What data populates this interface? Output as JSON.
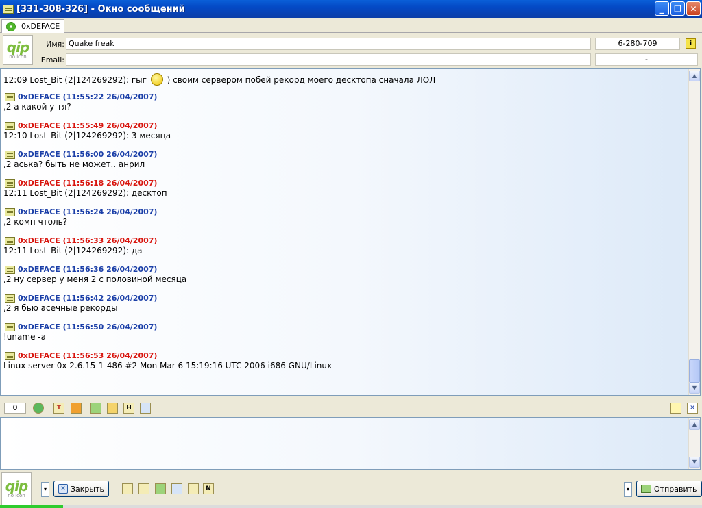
{
  "window": {
    "title": "[331-308-326] - Окно сообщений",
    "controls": {
      "minimize": "_",
      "maximize": "❐",
      "close": "✕"
    }
  },
  "tab": {
    "label": "0xDEFACE",
    "icon": "flower-icon"
  },
  "logo": {
    "text": "qip",
    "sub": "no icon"
  },
  "contact": {
    "name_label": "Имя:",
    "name_value": "Quake freak",
    "email_label": "Email:",
    "email_value": "",
    "uin": "6-280-709",
    "uin_secondary": "-",
    "info_icon": "i"
  },
  "chat": {
    "first_line_prefix": "12:09 Lost_Bit (2|124269292): гыг",
    "first_line_suffix": ") своим сервером побей рекорд моего десктопа сначала ЛОЛ",
    "messages": [
      {
        "dir": "out",
        "header": "0xDEFACE (11:55:22 26/04/2007)",
        "text": ",2 а какой у тя?"
      },
      {
        "dir": "in",
        "header": "0xDEFACE (11:55:49 26/04/2007)",
        "text": "12:10 Lost_Bit (2|124269292): 3 месяца"
      },
      {
        "dir": "out",
        "header": "0xDEFACE (11:56:00 26/04/2007)",
        "text": ",2 аська? быть не может.. анрил"
      },
      {
        "dir": "in",
        "header": "0xDEFACE (11:56:18 26/04/2007)",
        "text": "12:11 Lost_Bit (2|124269292): десктоп"
      },
      {
        "dir": "out",
        "header": "0xDEFACE (11:56:24 26/04/2007)",
        "text": ",2 комп чтоль?"
      },
      {
        "dir": "in",
        "header": "0xDEFACE (11:56:33 26/04/2007)",
        "text": "12:11 Lost_Bit (2|124269292): да"
      },
      {
        "dir": "out",
        "header": "0xDEFACE (11:56:36 26/04/2007)",
        "text": ",2 ну сервер у меня 2 с половиной месяца"
      },
      {
        "dir": "out",
        "header": "0xDEFACE (11:56:42 26/04/2007)",
        "text": ",2 я бью асечные рекорды"
      },
      {
        "dir": "out",
        "header": "0xDEFACE (11:56:50 26/04/2007)",
        "text": "!uname -a"
      },
      {
        "dir": "in",
        "header": "0xDEFACE (11:56:53 26/04/2007)",
        "text": "Linux server-0x 2.6.15-1-486 #2 Mon Mar 6 15:19:16 UTC 2006 i686 GNU/Linux"
      }
    ]
  },
  "input_toolbar": {
    "char_count": "0",
    "icons": [
      "smiley-icon",
      "text-format-icon",
      "color-icon",
      "save-icon",
      "folder-icon",
      "history-icon",
      "screenshot-icon"
    ],
    "icon_glyphs": {
      "text_format": "T",
      "history": "H"
    }
  },
  "bottom": {
    "close_label": "Закрыть",
    "send_label": "Отправить",
    "dropdown_glyph": "▾"
  },
  "colors": {
    "outgoing": "#1b3fa8",
    "incoming": "#d8150e",
    "titlebar": "#0449c5"
  }
}
